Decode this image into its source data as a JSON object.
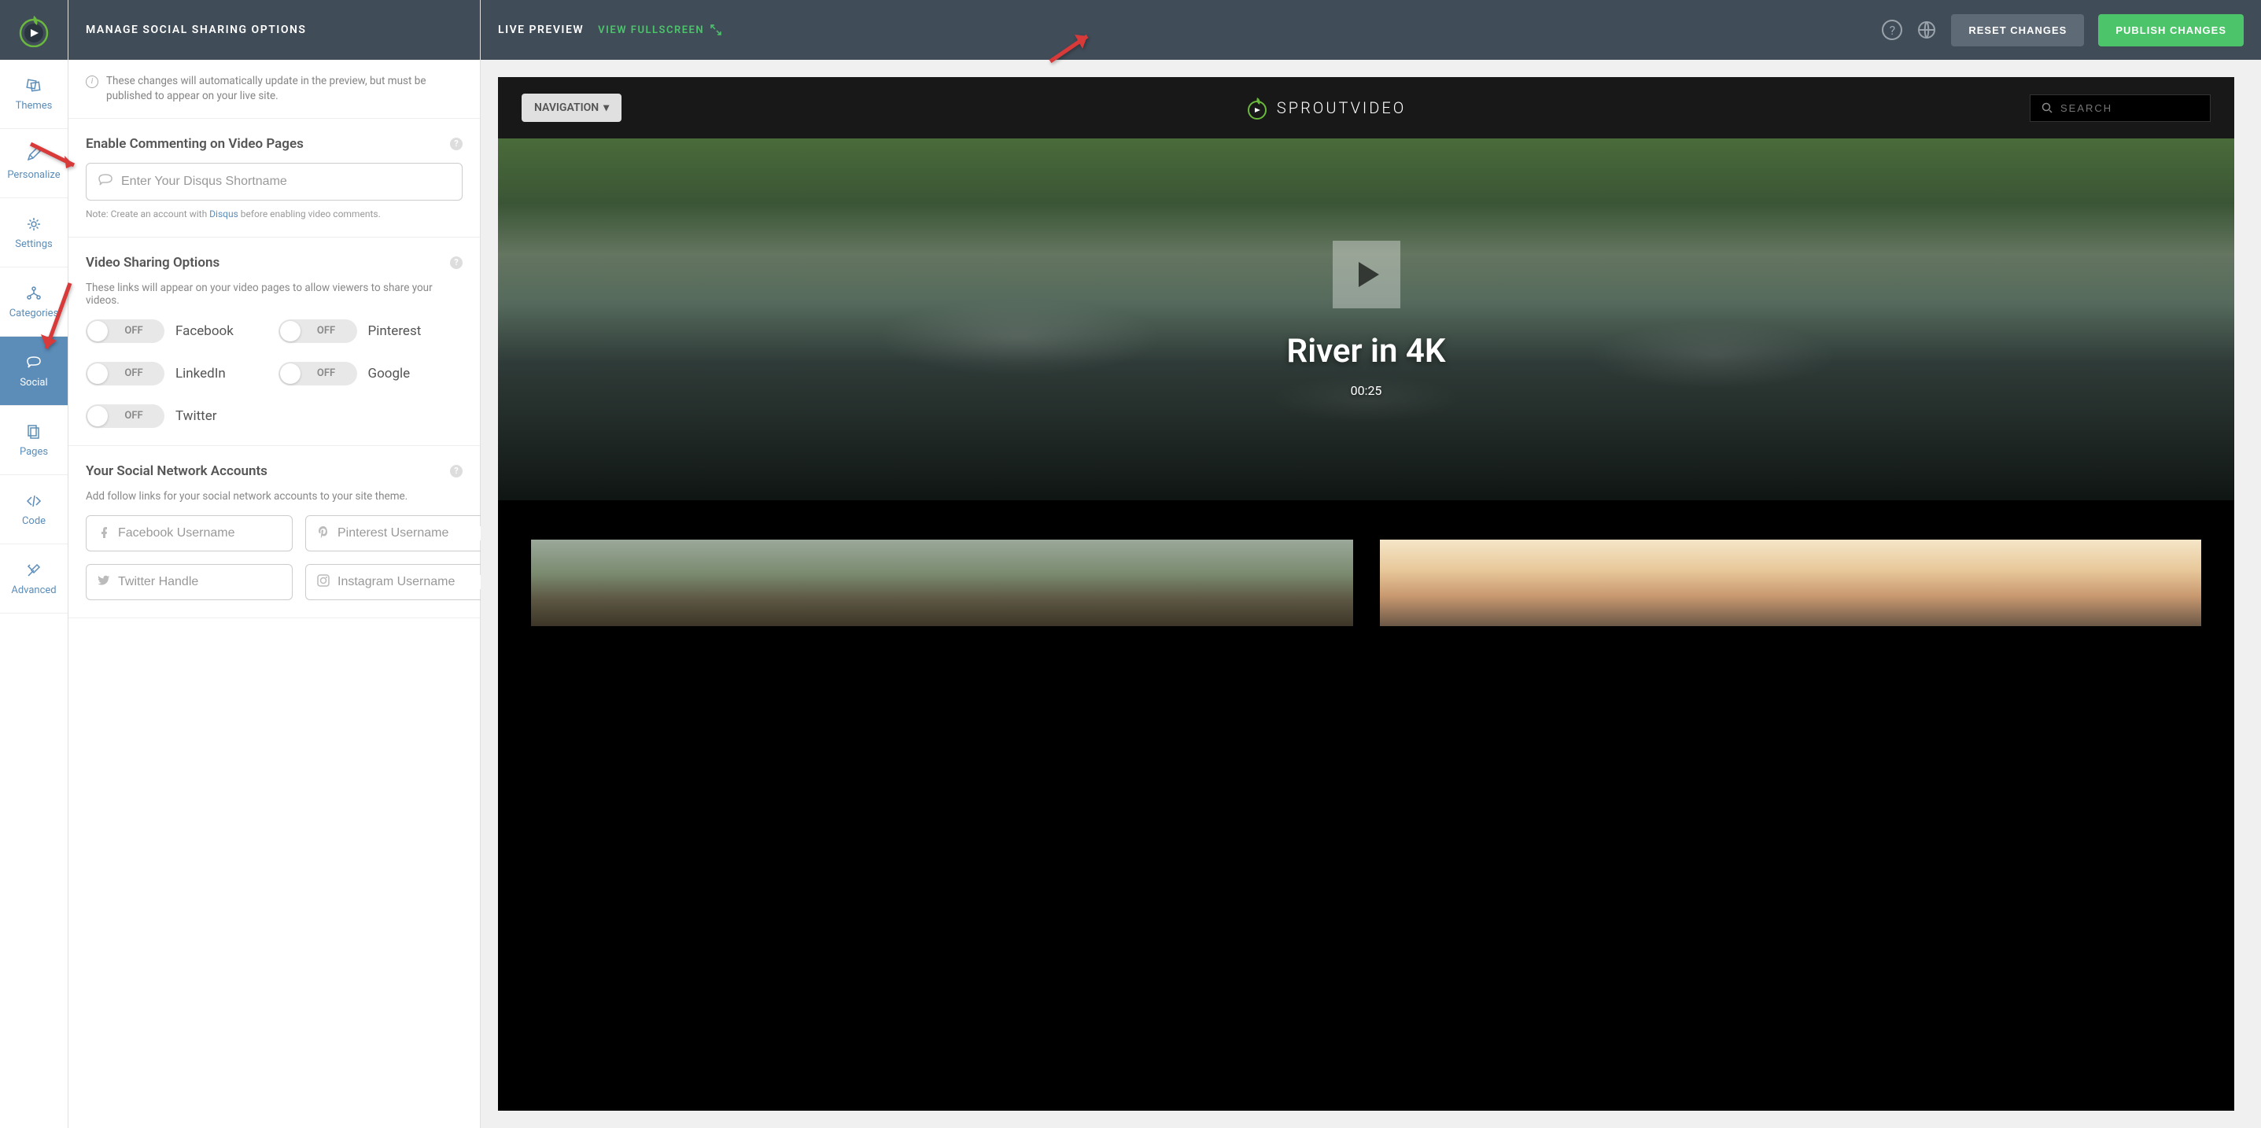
{
  "header": {
    "title": "MANAGE SOCIAL SHARING OPTIONS",
    "live_preview": "LIVE PREVIEW",
    "view_fullscreen": "VIEW FULLSCREEN",
    "reset": "RESET CHANGES",
    "publish": "PUBLISH CHANGES"
  },
  "sidebar": {
    "items": [
      {
        "label": "Themes",
        "icon": "themes"
      },
      {
        "label": "Personalize",
        "icon": "personalize"
      },
      {
        "label": "Settings",
        "icon": "settings"
      },
      {
        "label": "Categories",
        "icon": "categories"
      },
      {
        "label": "Social",
        "icon": "social",
        "active": true
      },
      {
        "label": "Pages",
        "icon": "pages"
      },
      {
        "label": "Code",
        "icon": "code"
      },
      {
        "label": "Advanced",
        "icon": "advanced"
      }
    ]
  },
  "info_banner": "These changes will automatically update in the preview, but must be published to appear on your live site.",
  "commenting": {
    "title": "Enable Commenting on Video Pages",
    "placeholder": "Enter Your Disqus Shortname",
    "note_prefix": "Note: Create an account with ",
    "note_link": "Disqus",
    "note_suffix": " before enabling video comments."
  },
  "sharing": {
    "title": "Video Sharing Options",
    "desc": "These links will appear on your video pages to allow viewers to share your videos.",
    "toggles": [
      {
        "name": "Facebook",
        "state": "OFF"
      },
      {
        "name": "Pinterest",
        "state": "OFF"
      },
      {
        "name": "LinkedIn",
        "state": "OFF"
      },
      {
        "name": "Google",
        "state": "OFF"
      },
      {
        "name": "Twitter",
        "state": "OFF"
      }
    ]
  },
  "accounts": {
    "title": "Your Social Network Accounts",
    "desc": "Add follow links for your social network accounts to your site theme.",
    "fields": [
      {
        "placeholder": "Facebook Username",
        "icon": "facebook"
      },
      {
        "placeholder": "Pinterest Username",
        "icon": "pinterest"
      },
      {
        "placeholder": "Twitter Handle",
        "icon": "twitter"
      },
      {
        "placeholder": "Instagram Username",
        "icon": "instagram"
      }
    ]
  },
  "preview": {
    "nav_button": "NAVIGATION",
    "brand": "SPROUTVIDEO",
    "search_placeholder": "SEARCH",
    "hero_title": "River in 4K",
    "hero_time": "00:25"
  }
}
